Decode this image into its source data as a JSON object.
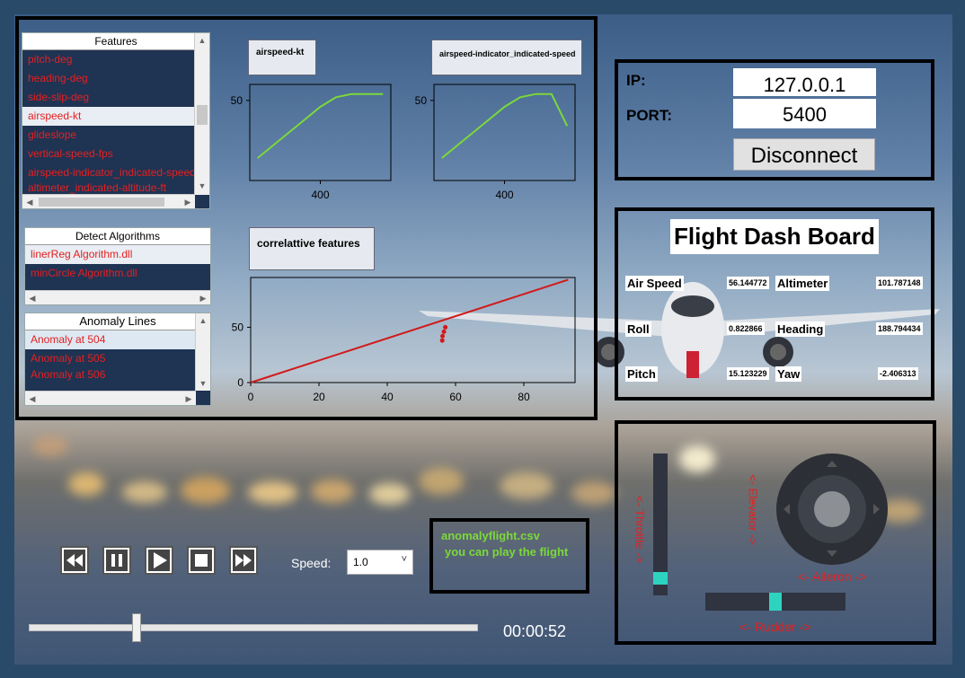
{
  "features": {
    "header": "Features",
    "items": [
      "pitch-deg",
      "heading-deg",
      "side-slip-deg",
      "airspeed-kt",
      "glideslope",
      "vertical-speed-fps",
      "airspeed-indicator_indicated-speed-kt",
      "altimeter_indicated-altitude-ft"
    ],
    "selected": "airspeed-kt"
  },
  "detect": {
    "header": "Detect Algorithms",
    "items": [
      "linerReg Algorithm.dll",
      "minCircle Algorithm.dll"
    ]
  },
  "anomaly": {
    "header": "Anomaly Lines",
    "items": [
      "Anomaly at 504",
      "Anomaly at 505",
      "Anomaly at 506"
    ]
  },
  "chart_data": [
    {
      "type": "line",
      "title": "airspeed-kt",
      "x": [
        360,
        370,
        380,
        390,
        400,
        410,
        420,
        430,
        440
      ],
      "values": [
        32,
        36,
        40,
        44,
        48,
        51,
        52,
        52,
        52
      ],
      "xticks": [
        "400"
      ],
      "yticks": [
        "50"
      ],
      "color": "#7bd93a"
    },
    {
      "type": "line",
      "title": "airspeed-indicator_indicated-speed",
      "x": [
        360,
        370,
        380,
        390,
        400,
        410,
        420,
        430,
        440
      ],
      "values": [
        32,
        36,
        40,
        44,
        48,
        51,
        52,
        52,
        42
      ],
      "xticks": [
        "400"
      ],
      "yticks": [
        "50"
      ],
      "color": "#7bd93a"
    },
    {
      "type": "scatter",
      "title": "correlattive features",
      "xlim": [
        0,
        95
      ],
      "ylim": [
        0,
        95
      ],
      "xticks": [
        "0",
        "20",
        "40",
        "60",
        "80"
      ],
      "yticks": [
        "0",
        "50"
      ],
      "regression": {
        "x": [
          0,
          93
        ],
        "y": [
          0,
          93
        ]
      },
      "points": [
        [
          57,
          50
        ],
        [
          56.6,
          46
        ],
        [
          56.2,
          42
        ],
        [
          56.1,
          38
        ]
      ],
      "color": "#d11a1a"
    }
  ],
  "connection": {
    "ip_label": "IP:",
    "ip_value": "127.0.0.1",
    "port_label": "PORT:",
    "port_value": "5400",
    "disconnect_label": "Disconnect"
  },
  "dashboard": {
    "title": "Flight Dash Board",
    "airspeed_label": "Air Speed",
    "airspeed_value": "56.144772",
    "altimeter_label": "Altimeter",
    "altimeter_value": "101.787148",
    "roll_label": "Roll",
    "roll_value": "0.822866",
    "heading_label": "Heading",
    "heading_value": "188.794434",
    "pitch_label": "Pitch",
    "pitch_value": "15.123229",
    "yaw_label": "Yaw",
    "yaw_value": "-2.406313"
  },
  "player": {
    "speed_label": "Speed:",
    "speed_value": "1.0",
    "time": "00:00:52",
    "progress": 0.24,
    "file_name": "anomalyflight.csv",
    "file_msg": "you can play the flight"
  },
  "joystick": {
    "throttle_label": "<- Throttle ->",
    "elevator_label": "<- Elevator ->",
    "aileron_label": "<- Aileron ->",
    "rudder_label": "<- Rudder ->",
    "throttle": 0.08,
    "rudder": 0.5
  },
  "colors": {
    "accent_red": "#e52020",
    "chart_green": "#7bd93a",
    "cyan": "#2ed3c0"
  }
}
